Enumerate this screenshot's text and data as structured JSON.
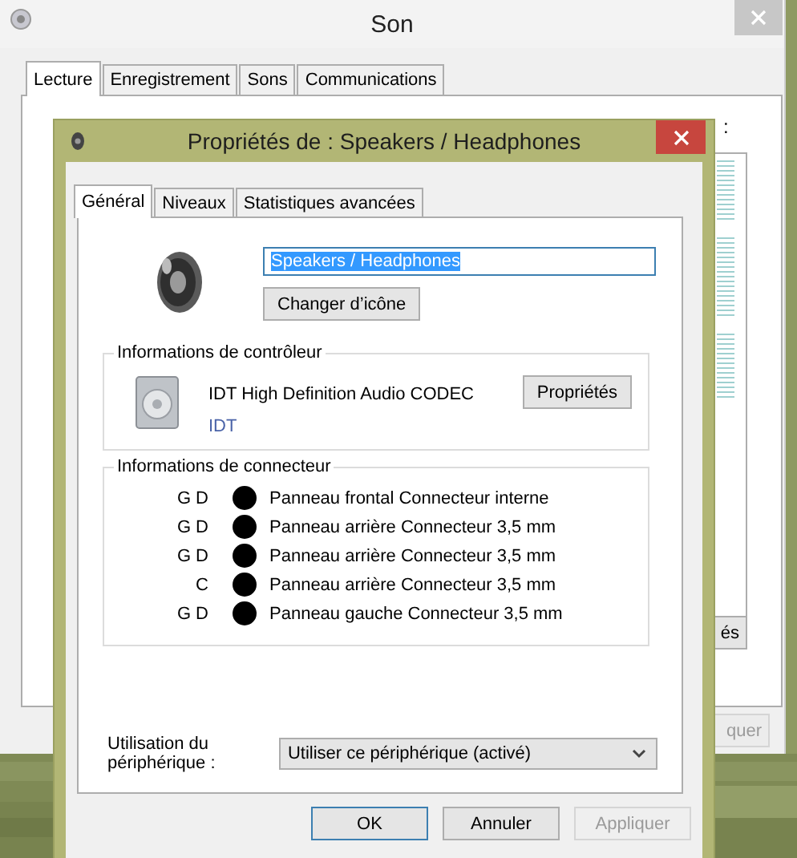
{
  "main_window": {
    "title": "Son",
    "tabs": [
      {
        "label": "Lecture",
        "selected": true
      },
      {
        "label": "Enregistrement",
        "selected": false
      },
      {
        "label": "Sons",
        "selected": false
      },
      {
        "label": "Communications",
        "selected": false
      }
    ],
    "instruction": ":",
    "buttons": [
      {
        "label": "és",
        "disabled": false
      },
      {
        "label": "quer",
        "disabled": true
      }
    ]
  },
  "dialog": {
    "title": "Propriétés de : Speakers / Headphones",
    "tabs": [
      {
        "label": "Général",
        "selected": true
      },
      {
        "label": "Niveaux",
        "selected": false
      },
      {
        "label": "Statistiques avancées",
        "selected": false
      }
    ],
    "device_name": "Speakers / Headphones",
    "change_icon_button": "Changer d’icône",
    "controller": {
      "heading": "Informations de contrôleur",
      "name": "IDT High Definition Audio CODEC",
      "vendor": "IDT",
      "properties_button": "Propriétés"
    },
    "connectors": {
      "heading": "Informations de connecteur",
      "items": [
        {
          "channels": "G D",
          "label": "Panneau frontal Connecteur interne"
        },
        {
          "channels": "G D",
          "label": "Panneau arrière Connecteur 3,5 mm"
        },
        {
          "channels": "G D",
          "label": "Panneau arrière Connecteur 3,5 mm"
        },
        {
          "channels": "C",
          "label": "Panneau arrière Connecteur 3,5 mm"
        },
        {
          "channels": "G D",
          "label": "Panneau gauche Connecteur 3,5 mm"
        }
      ]
    },
    "device_usage": {
      "label": "Utilisation du périphérique :",
      "value": "Utiliser ce périphérique (activé)"
    },
    "buttons": [
      {
        "label": "OK",
        "default": true,
        "disabled": false
      },
      {
        "label": "Annuler",
        "default": false,
        "disabled": false
      },
      {
        "label": "Appliquer",
        "default": false,
        "disabled": true
      }
    ]
  }
}
